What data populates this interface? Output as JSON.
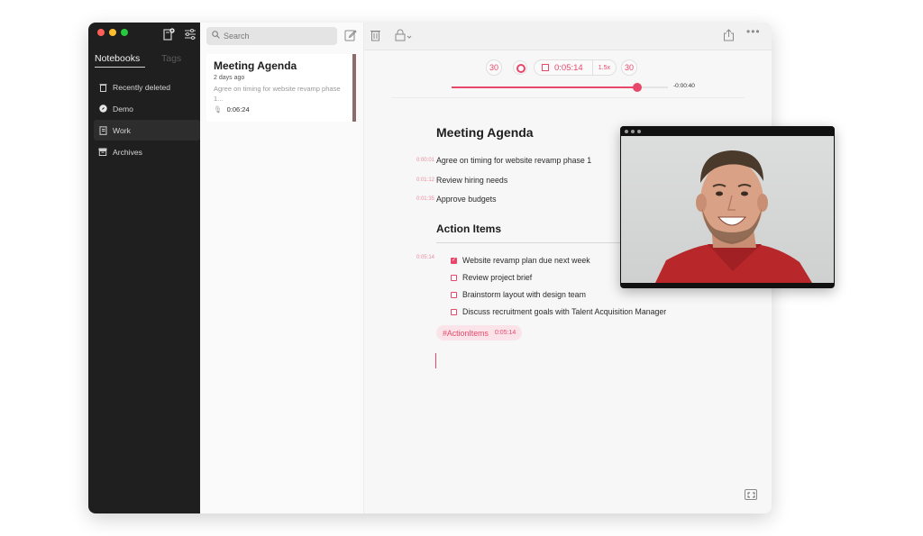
{
  "sidebar": {
    "tabs": {
      "notebooks": "Notebooks",
      "tags": "Tags"
    },
    "items": [
      {
        "label": "Recently deleted",
        "icon": "trash-icon"
      },
      {
        "label": "Demo",
        "icon": "compass-icon"
      },
      {
        "label": "Work",
        "icon": "notebook-icon",
        "selected": true
      },
      {
        "label": "Archives",
        "icon": "archive-icon"
      }
    ]
  },
  "toolbar": {
    "search_placeholder": "Search"
  },
  "note_list": {
    "card": {
      "title": "Meeting Agenda",
      "date": "2 days ago",
      "preview": "Agree on timing for website revamp phase 1...",
      "duration": "0:06:24"
    }
  },
  "player": {
    "skip_back": "30",
    "skip_forward": "30",
    "current_time": "0:05:14",
    "speed": "1.5x",
    "remaining": "-0:00:40",
    "progress": 0.86
  },
  "document": {
    "title": "Meeting Agenda",
    "agenda": [
      {
        "ts": "0:00:01",
        "text": "Agree on timing for website revamp phase 1"
      },
      {
        "ts": "0:01:12",
        "text": "Review hiring needs"
      },
      {
        "ts": "0:01:35",
        "text": "Approve budgets"
      }
    ],
    "section_title": "Action Items",
    "section_ts": "0:05:14",
    "tasks": [
      {
        "text": "Website revamp plan due next week",
        "checked": true
      },
      {
        "text": "Review project brief",
        "checked": false
      },
      {
        "text": "Brainstorm layout with design team",
        "checked": false
      },
      {
        "text": "Discuss recruitment goals with Talent Acquisition Manager",
        "checked": false
      }
    ],
    "tag": {
      "label": "#ActionItems",
      "ts": "0:05:14"
    }
  },
  "colors": {
    "accent": "#e8476a",
    "sidebar_bg": "#1f1f1f",
    "light_red": "#ff5f56",
    "light_yellow": "#ffbd2e",
    "light_green": "#27c93f"
  }
}
